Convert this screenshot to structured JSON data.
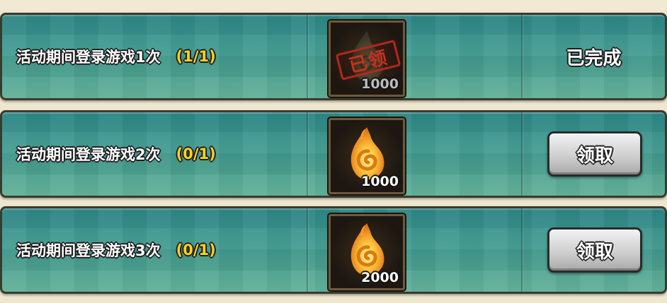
{
  "tasks": [
    {
      "label": "活动期间登录游戏1次",
      "progress": "(1/1)",
      "reward_amount": "1000",
      "reward_icon": "flame-swirl-icon",
      "claimed_stamp": "已领",
      "status_text": "已完成"
    },
    {
      "label": "活动期间登录游戏2次",
      "progress": "(0/1)",
      "reward_amount": "1000",
      "reward_icon": "flame-swirl-icon",
      "button_label": "领取"
    },
    {
      "label": "活动期间登录游戏3次",
      "progress": "(0/1)",
      "reward_amount": "2000",
      "reward_icon": "flame-swirl-icon",
      "button_label": "领取"
    }
  ],
  "colors": {
    "row_bg": "#3f9a8f",
    "progress_text": "#ffd21f",
    "stamp_red": "#c8301f",
    "button_gray": "#cfcfcf"
  }
}
